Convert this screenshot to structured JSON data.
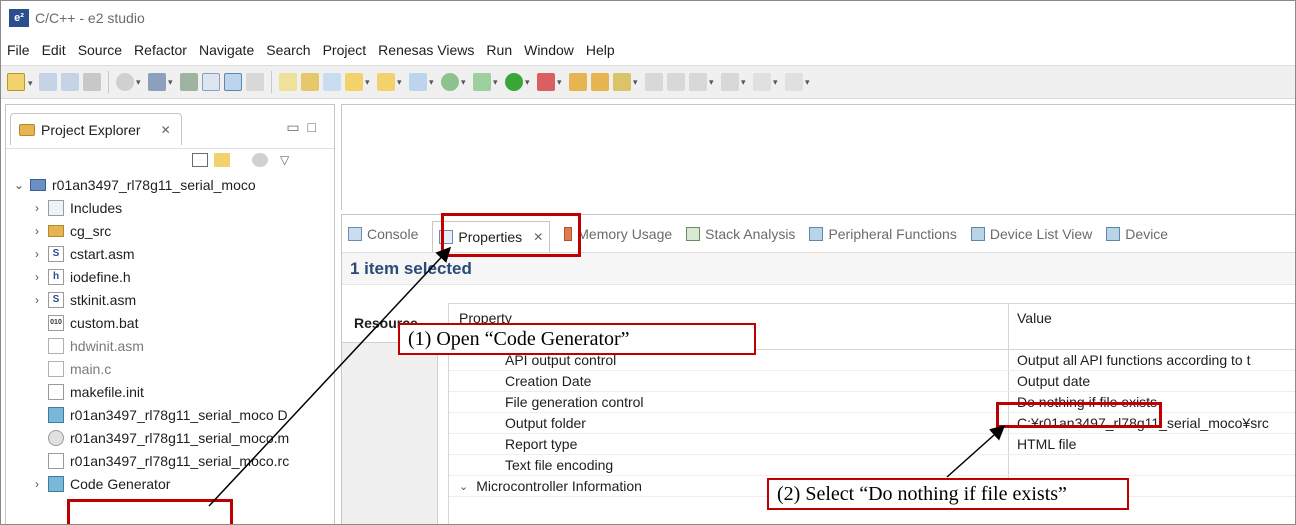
{
  "window": {
    "title": "C/C++ - e2 studio",
    "logo": "e²"
  },
  "menu": [
    "File",
    "Edit",
    "Source",
    "Refactor",
    "Navigate",
    "Search",
    "Project",
    "Renesas Views",
    "Run",
    "Window",
    "Help"
  ],
  "explorer": {
    "tab_label": "Project Explorer",
    "project": "r01an3497_rl78g11_serial_moco",
    "items": [
      {
        "label": "Includes",
        "expandable": true,
        "icon": "includes-icon"
      },
      {
        "label": "cg_src",
        "expandable": true,
        "icon": "folder-icon"
      },
      {
        "label": "cstart.asm",
        "expandable": true,
        "icon": "asm-file-icon",
        "glyph": "S"
      },
      {
        "label": "iodefine.h",
        "expandable": true,
        "icon": "header-file-icon",
        "glyph": "h"
      },
      {
        "label": "stkinit.asm",
        "expandable": true,
        "icon": "asm-file-icon",
        "glyph": "S"
      },
      {
        "label": "custom.bat",
        "expandable": false,
        "icon": "bat-file-icon",
        "glyph": "010"
      },
      {
        "label": "hdwinit.asm",
        "expandable": false,
        "icon": "excluded-file-icon",
        "muted": true
      },
      {
        "label": "main.c",
        "expandable": false,
        "icon": "excluded-file-icon",
        "muted": true
      },
      {
        "label": "makefile.init",
        "expandable": false,
        "icon": "text-file-icon"
      },
      {
        "label": "r01an3497_rl78g11_serial_moco D",
        "expandable": false,
        "icon": "debug-config-icon"
      },
      {
        "label": "r01an3497_rl78g11_serial_moco.m",
        "expandable": false,
        "icon": "map-file-icon"
      },
      {
        "label": "r01an3497_rl78g11_serial_moco.rc",
        "expandable": false,
        "icon": "text-file-icon"
      },
      {
        "label": "Code Generator",
        "expandable": true,
        "icon": "code-generator-icon"
      }
    ]
  },
  "views": {
    "tabs": [
      {
        "label": "Console",
        "icon": "console-icon"
      },
      {
        "label": "Properties",
        "icon": "properties-icon",
        "active": true
      },
      {
        "label": "Memory Usage",
        "icon": "memory-usage-icon"
      },
      {
        "label": "Stack Analysis",
        "icon": "stack-analysis-icon"
      },
      {
        "label": "Peripheral Functions",
        "icon": "peripheral-functions-icon"
      },
      {
        "label": "Device List View",
        "icon": "device-list-icon"
      },
      {
        "label": "Device",
        "icon": "device-icon"
      }
    ],
    "selection_title": "1 item selected",
    "side_tab": "Resource",
    "columns": {
      "property": "Property",
      "value": "Value"
    },
    "rows": [
      {
        "property": "API output control",
        "value": "Output all API functions according to t"
      },
      {
        "property": "Creation Date",
        "value": "Output date"
      },
      {
        "property": "File generation control",
        "value": "Do nothing if file exists"
      },
      {
        "property": "Output folder",
        "value": "C:¥r01an3497_rl78g11_serial_moco¥src"
      },
      {
        "property": "Report type",
        "value": "HTML file"
      },
      {
        "property": "Text file encoding",
        "value": ""
      }
    ],
    "group": "Microcontroller Information"
  },
  "annotations": {
    "step1": "(1) Open “Code Generator”",
    "step2": "(2) Select “Do nothing if file exists”",
    "highlight_color": "#c00000"
  }
}
